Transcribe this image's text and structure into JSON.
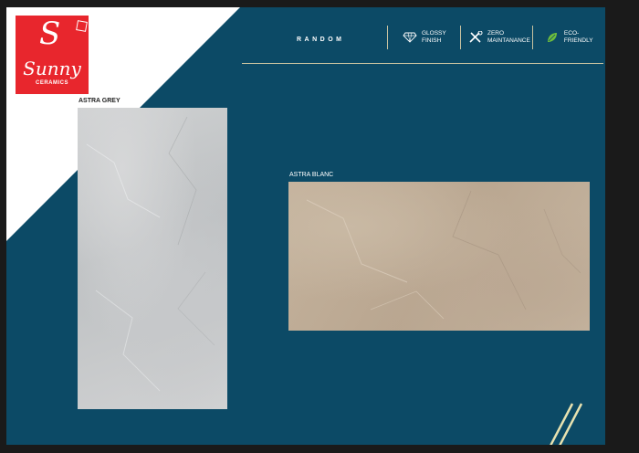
{
  "brand": {
    "name": "Sunny",
    "subtitle": "CERAMICS"
  },
  "header": {
    "collection": "RANDOM",
    "features": [
      {
        "icon": "diamond-icon",
        "line1": "GLOSSY",
        "line2": "FINISH"
      },
      {
        "icon": "tools-icon",
        "line1": "ZERO",
        "line2": "MAINTANANCE"
      },
      {
        "icon": "leaf-icon",
        "line1": "ECO-FRIENDLY",
        "line2": ""
      }
    ]
  },
  "tiles": [
    {
      "name": "ASTRA GREY"
    },
    {
      "name": "ASTRA BLANC"
    }
  ],
  "colors": {
    "background": "#0c4a66",
    "brand_red": "#e8262d",
    "accent_line": "#c8c2a0"
  }
}
